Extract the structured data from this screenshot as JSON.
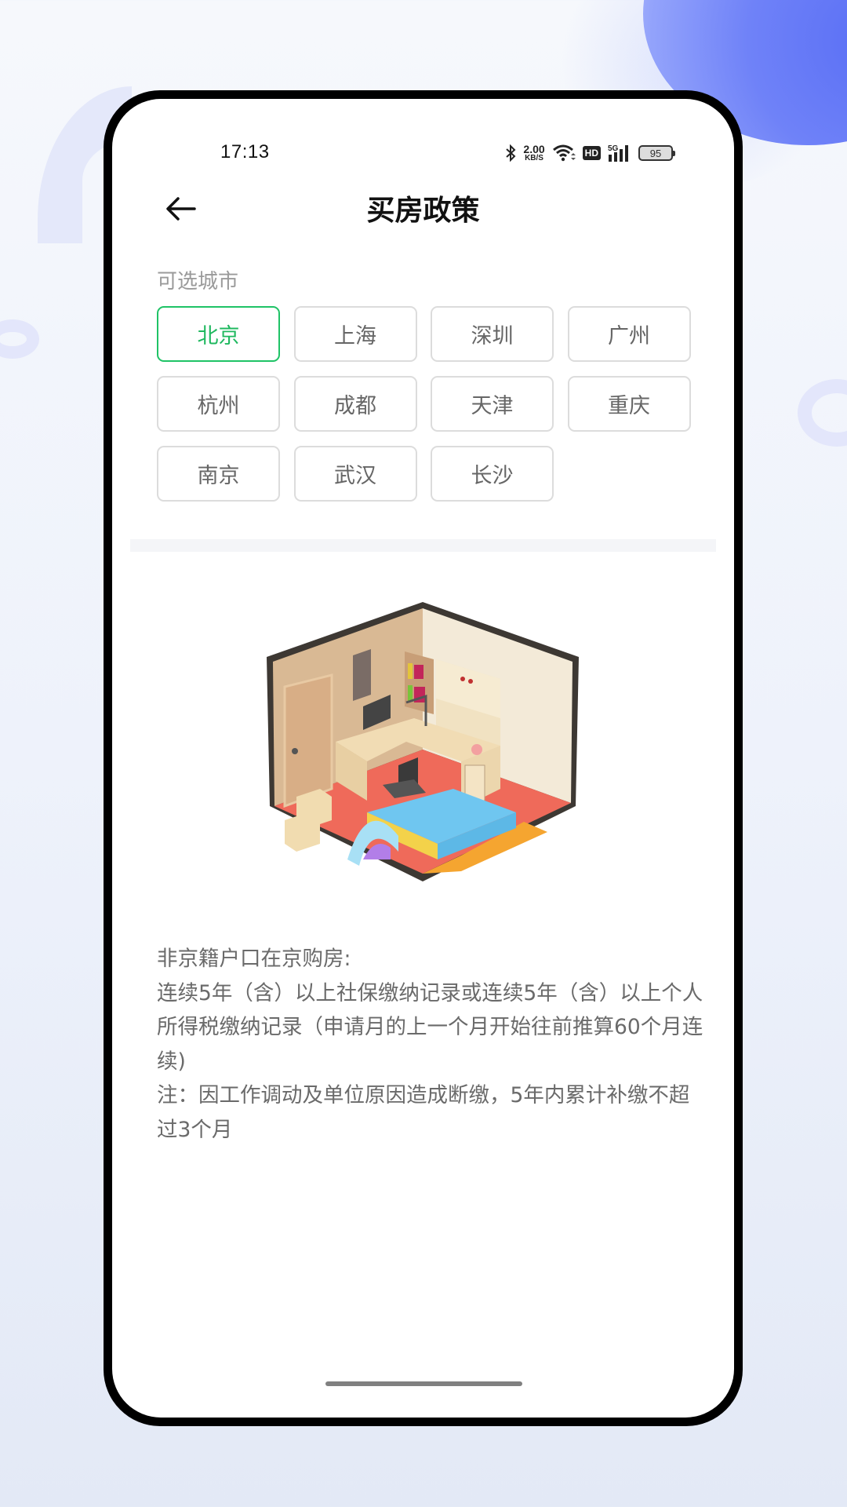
{
  "status_bar": {
    "time": "17:13",
    "network_speed_value": "2.00",
    "network_speed_unit": "KB/S",
    "hd_label": "HD",
    "network_type": "5G",
    "battery_level": "95",
    "icons": [
      "bluetooth-icon",
      "wifi-icon",
      "hd-icon",
      "signal-5g-icon",
      "battery-icon"
    ]
  },
  "header": {
    "back_icon": "arrow-left-icon",
    "title": "买房政策"
  },
  "city_section": {
    "label": "可选城市",
    "selected_index": 0,
    "accent_color": "#1fc366",
    "cities": [
      "北京",
      "上海",
      "深圳",
      "广州",
      "杭州",
      "成都",
      "天津",
      "重庆",
      "南京",
      "武汉",
      "长沙"
    ]
  },
  "illustration": {
    "semantic": "isometric-bedroom-illustration"
  },
  "policy": {
    "lines": [
      "非京籍户口在京购房:",
      "连续5年（含）以上社保缴纳记录或连续5年（含）以上个人所得税缴纳记录（申请月的上一个月开始往前推算60个月连续)",
      "注：因工作调动及单位原因造成断缴，5年内累计补缴不超过3个月"
    ]
  }
}
